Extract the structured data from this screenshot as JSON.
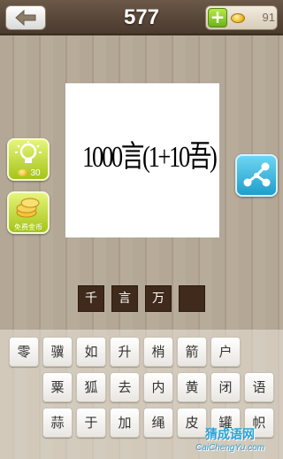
{
  "header": {
    "level": "577",
    "coins": "91",
    "back_icon": "back-arrow-icon",
    "add_icon": "plus-icon",
    "coin_icon": "coin-icon"
  },
  "puzzle": {
    "image_text": "1000言(1+10吾)"
  },
  "side_buttons": {
    "hint_cost": "30",
    "hint_icon": "lightbulb-icon",
    "free_coins_label": "免费金币",
    "free_coins_icon": "coin-stack-icon",
    "share_icon": "share-icon"
  },
  "answer": {
    "slots": [
      "千",
      "言",
      "万",
      ""
    ]
  },
  "keyboard": {
    "row1": [
      "零",
      "骥",
      "如",
      "升",
      "梢",
      "箭",
      "户"
    ],
    "row2": [
      "粟",
      "狐",
      "去",
      "内",
      "黄",
      "闭",
      "语"
    ],
    "row3": [
      "蒜",
      "于",
      "加",
      "绳",
      "皮",
      "罐",
      "帜"
    ]
  },
  "watermark": {
    "cn": "猜成语网",
    "en": "CaiChengYu.com"
  },
  "colors": {
    "accent_green": "#a4c418",
    "accent_blue": "#1d9fcc",
    "topbar": "#4a3a2d",
    "answer_slot": "#3f2a1b"
  }
}
